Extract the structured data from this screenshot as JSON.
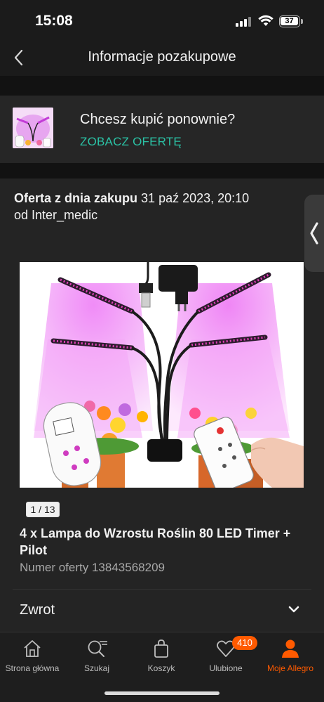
{
  "status_bar": {
    "time": "15:08",
    "battery": "37"
  },
  "header": {
    "title": "Informacje pozakupowe",
    "back_icon": "chevron-left-icon"
  },
  "rebuy": {
    "question": "Chcesz kupić ponownie?",
    "link": "ZOBACZ OFERTĘ"
  },
  "offer": {
    "date_label": "Oferta z dnia zakupu",
    "date_value": "31 paź 2023, 20:10",
    "seller": "od Inter_medic",
    "image_counter": "1 / 13",
    "title": "4 x Lampa do Wzrostu Roślin 80 LED Timer + Pilot",
    "offer_number": "Numer oferty 13843568209"
  },
  "return_section": {
    "label": "Zwrot"
  },
  "tabs": [
    {
      "label": "Strona główna",
      "icon": "home-icon"
    },
    {
      "label": "Szukaj",
      "icon": "search-icon"
    },
    {
      "label": "Koszyk",
      "icon": "bag-icon"
    },
    {
      "label": "Ulubione",
      "icon": "heart-icon",
      "badge": "410"
    },
    {
      "label": "Moje Allegro",
      "icon": "user-icon",
      "active": true
    }
  ],
  "colors": {
    "accent": "#ff5a00",
    "link": "#2bc2a5",
    "background": "#1b1b1b",
    "card": "#262626"
  }
}
